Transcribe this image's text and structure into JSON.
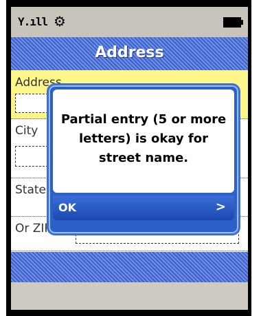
{
  "status_bar": {
    "signal": "Y.ıll",
    "gear_icon": "gear-icon",
    "battery_icon": "battery-icon"
  },
  "title": "Address",
  "form": {
    "address_label": "Address",
    "city_label": "City",
    "state_label": "State",
    "zip_label": "Or ZIP"
  },
  "dialog": {
    "message": "Partial entry (5 or more letters) is okay for street name.",
    "ok_label": "OK",
    "arrow": ">"
  },
  "colors": {
    "title_bar": "#4a6fd6",
    "highlight_row": "#fff78a",
    "dialog_border": "#3c71d4",
    "ok_bar": "#2b5fcd"
  }
}
